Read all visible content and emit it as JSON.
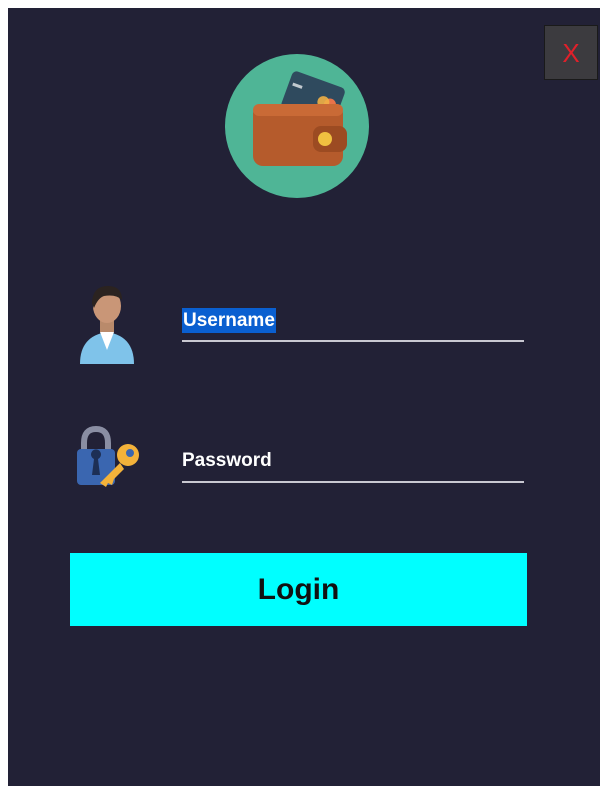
{
  "window": {
    "close_label": "X"
  },
  "logo": {
    "icon": "wallet-icon"
  },
  "form": {
    "username": {
      "icon": "user-icon",
      "value": "Username",
      "placeholder": "Username"
    },
    "password": {
      "icon": "lock-key-icon",
      "value": "",
      "placeholder": "Password"
    },
    "login_label": "Login"
  },
  "colors": {
    "background": "#222136",
    "accent": "#00ffff",
    "close": "#e0202a",
    "selection": "#0a5fd0"
  }
}
